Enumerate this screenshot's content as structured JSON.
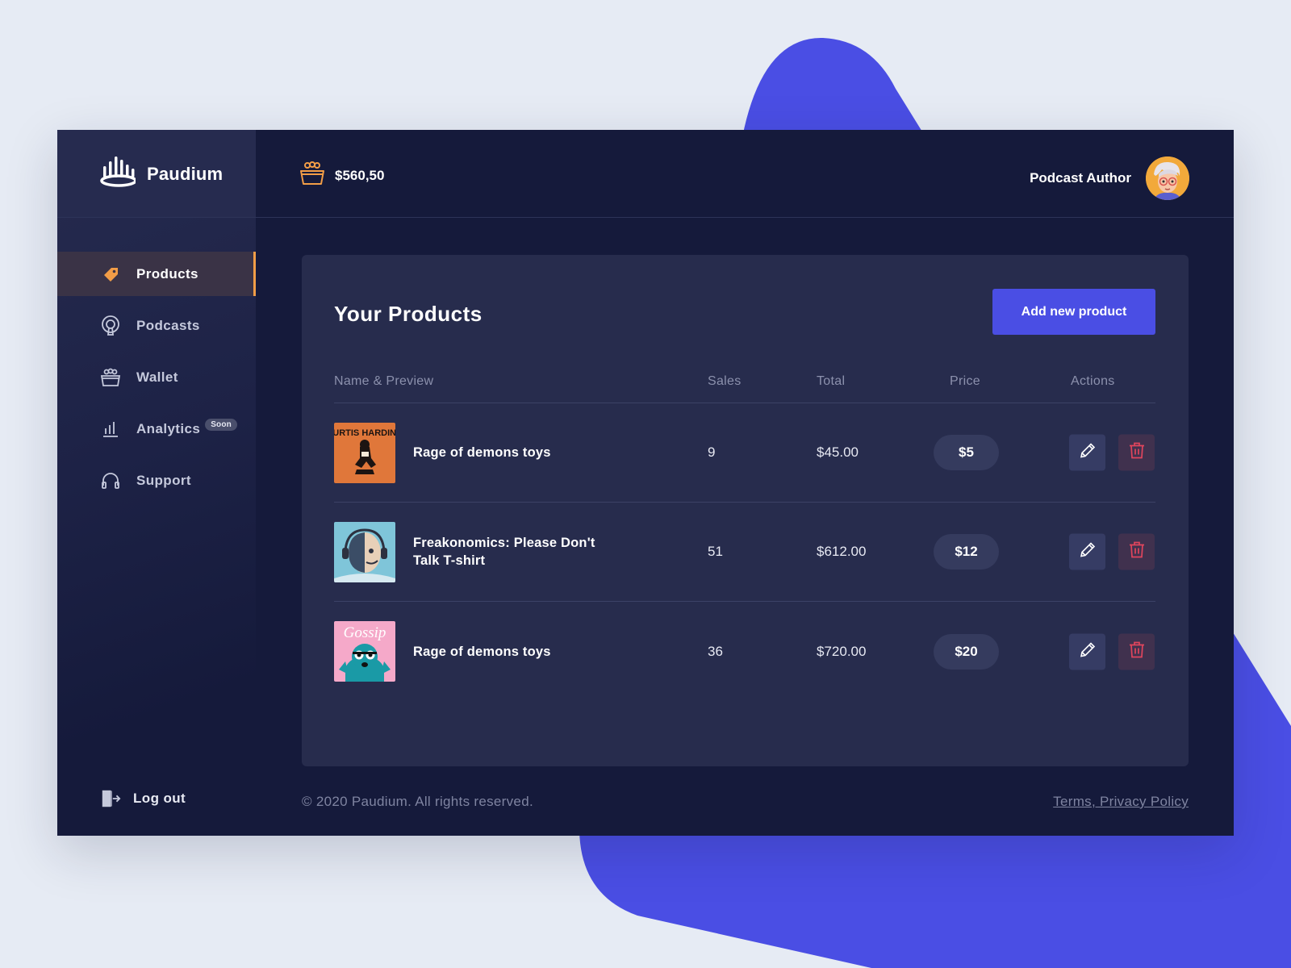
{
  "brand": {
    "name": "Paudium",
    "logo_icon": "podium-logo-icon"
  },
  "header": {
    "balance": "$560,50",
    "balance_icon": "wallet-basket-icon",
    "user_name": "Podcast Author",
    "avatar_icon": "user-avatar"
  },
  "sidebar": {
    "items": [
      {
        "label": "Products",
        "icon": "tag-icon",
        "active": true
      },
      {
        "label": "Podcasts",
        "icon": "podcast-icon",
        "active": false
      },
      {
        "label": "Wallet",
        "icon": "wallet-icon",
        "active": false
      },
      {
        "label": "Analytics",
        "icon": "bar-chart-icon",
        "active": false,
        "badge": "Soon"
      },
      {
        "label": "Support",
        "icon": "headphones-icon",
        "active": false
      }
    ],
    "logout_label": "Log out"
  },
  "main": {
    "title": "Your Products",
    "add_button": "Add new product",
    "columns": [
      "Name & Preview",
      "Sales",
      "Total",
      "Price",
      "Actions"
    ],
    "rows": [
      {
        "name": "Rage of demons toys",
        "sales": "9",
        "total": "$45.00",
        "price": "$5",
        "thumb_text": "CURTIS HARDING"
      },
      {
        "name": "Freakonomics: Please Don't Talk T-shirt",
        "sales": "51",
        "total": "$612.00",
        "price": "$12",
        "thumb_text": ""
      },
      {
        "name": "Rage of demons toys",
        "sales": "36",
        "total": "$720.00",
        "price": "$20",
        "thumb_text": "Gossip"
      }
    ]
  },
  "footer": {
    "copyright": "© 2020 Paudium. All rights reserved.",
    "legal_link": "Terms, Privacy Policy"
  },
  "colors": {
    "background": "#e6ebf4",
    "blob": "#4a4ee4",
    "app_bg": "#151a3b",
    "panel": "#272c4d",
    "accent_orange": "#f29d47",
    "primary_button": "#4a4ee4",
    "delete_red": "#e0455d"
  }
}
